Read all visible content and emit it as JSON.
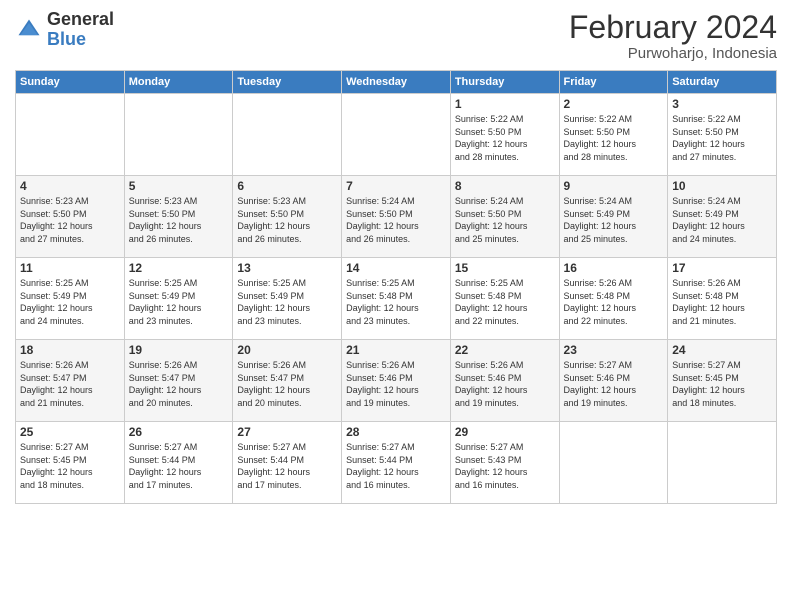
{
  "logo": {
    "general": "General",
    "blue": "Blue"
  },
  "title": "February 2024",
  "subtitle": "Purwoharjo, Indonesia",
  "weekdays": [
    "Sunday",
    "Monday",
    "Tuesday",
    "Wednesday",
    "Thursday",
    "Friday",
    "Saturday"
  ],
  "weeks": [
    [
      {
        "day": "",
        "info": ""
      },
      {
        "day": "",
        "info": ""
      },
      {
        "day": "",
        "info": ""
      },
      {
        "day": "",
        "info": ""
      },
      {
        "day": "1",
        "info": "Sunrise: 5:22 AM\nSunset: 5:50 PM\nDaylight: 12 hours\nand 28 minutes."
      },
      {
        "day": "2",
        "info": "Sunrise: 5:22 AM\nSunset: 5:50 PM\nDaylight: 12 hours\nand 28 minutes."
      },
      {
        "day": "3",
        "info": "Sunrise: 5:22 AM\nSunset: 5:50 PM\nDaylight: 12 hours\nand 27 minutes."
      }
    ],
    [
      {
        "day": "4",
        "info": "Sunrise: 5:23 AM\nSunset: 5:50 PM\nDaylight: 12 hours\nand 27 minutes."
      },
      {
        "day": "5",
        "info": "Sunrise: 5:23 AM\nSunset: 5:50 PM\nDaylight: 12 hours\nand 26 minutes."
      },
      {
        "day": "6",
        "info": "Sunrise: 5:23 AM\nSunset: 5:50 PM\nDaylight: 12 hours\nand 26 minutes."
      },
      {
        "day": "7",
        "info": "Sunrise: 5:24 AM\nSunset: 5:50 PM\nDaylight: 12 hours\nand 26 minutes."
      },
      {
        "day": "8",
        "info": "Sunrise: 5:24 AM\nSunset: 5:50 PM\nDaylight: 12 hours\nand 25 minutes."
      },
      {
        "day": "9",
        "info": "Sunrise: 5:24 AM\nSunset: 5:49 PM\nDaylight: 12 hours\nand 25 minutes."
      },
      {
        "day": "10",
        "info": "Sunrise: 5:24 AM\nSunset: 5:49 PM\nDaylight: 12 hours\nand 24 minutes."
      }
    ],
    [
      {
        "day": "11",
        "info": "Sunrise: 5:25 AM\nSunset: 5:49 PM\nDaylight: 12 hours\nand 24 minutes."
      },
      {
        "day": "12",
        "info": "Sunrise: 5:25 AM\nSunset: 5:49 PM\nDaylight: 12 hours\nand 23 minutes."
      },
      {
        "day": "13",
        "info": "Sunrise: 5:25 AM\nSunset: 5:49 PM\nDaylight: 12 hours\nand 23 minutes."
      },
      {
        "day": "14",
        "info": "Sunrise: 5:25 AM\nSunset: 5:48 PM\nDaylight: 12 hours\nand 23 minutes."
      },
      {
        "day": "15",
        "info": "Sunrise: 5:25 AM\nSunset: 5:48 PM\nDaylight: 12 hours\nand 22 minutes."
      },
      {
        "day": "16",
        "info": "Sunrise: 5:26 AM\nSunset: 5:48 PM\nDaylight: 12 hours\nand 22 minutes."
      },
      {
        "day": "17",
        "info": "Sunrise: 5:26 AM\nSunset: 5:48 PM\nDaylight: 12 hours\nand 21 minutes."
      }
    ],
    [
      {
        "day": "18",
        "info": "Sunrise: 5:26 AM\nSunset: 5:47 PM\nDaylight: 12 hours\nand 21 minutes."
      },
      {
        "day": "19",
        "info": "Sunrise: 5:26 AM\nSunset: 5:47 PM\nDaylight: 12 hours\nand 20 minutes."
      },
      {
        "day": "20",
        "info": "Sunrise: 5:26 AM\nSunset: 5:47 PM\nDaylight: 12 hours\nand 20 minutes."
      },
      {
        "day": "21",
        "info": "Sunrise: 5:26 AM\nSunset: 5:46 PM\nDaylight: 12 hours\nand 19 minutes."
      },
      {
        "day": "22",
        "info": "Sunrise: 5:26 AM\nSunset: 5:46 PM\nDaylight: 12 hours\nand 19 minutes."
      },
      {
        "day": "23",
        "info": "Sunrise: 5:27 AM\nSunset: 5:46 PM\nDaylight: 12 hours\nand 19 minutes."
      },
      {
        "day": "24",
        "info": "Sunrise: 5:27 AM\nSunset: 5:45 PM\nDaylight: 12 hours\nand 18 minutes."
      }
    ],
    [
      {
        "day": "25",
        "info": "Sunrise: 5:27 AM\nSunset: 5:45 PM\nDaylight: 12 hours\nand 18 minutes."
      },
      {
        "day": "26",
        "info": "Sunrise: 5:27 AM\nSunset: 5:44 PM\nDaylight: 12 hours\nand 17 minutes."
      },
      {
        "day": "27",
        "info": "Sunrise: 5:27 AM\nSunset: 5:44 PM\nDaylight: 12 hours\nand 17 minutes."
      },
      {
        "day": "28",
        "info": "Sunrise: 5:27 AM\nSunset: 5:44 PM\nDaylight: 12 hours\nand 16 minutes."
      },
      {
        "day": "29",
        "info": "Sunrise: 5:27 AM\nSunset: 5:43 PM\nDaylight: 12 hours\nand 16 minutes."
      },
      {
        "day": "",
        "info": ""
      },
      {
        "day": "",
        "info": ""
      }
    ]
  ]
}
